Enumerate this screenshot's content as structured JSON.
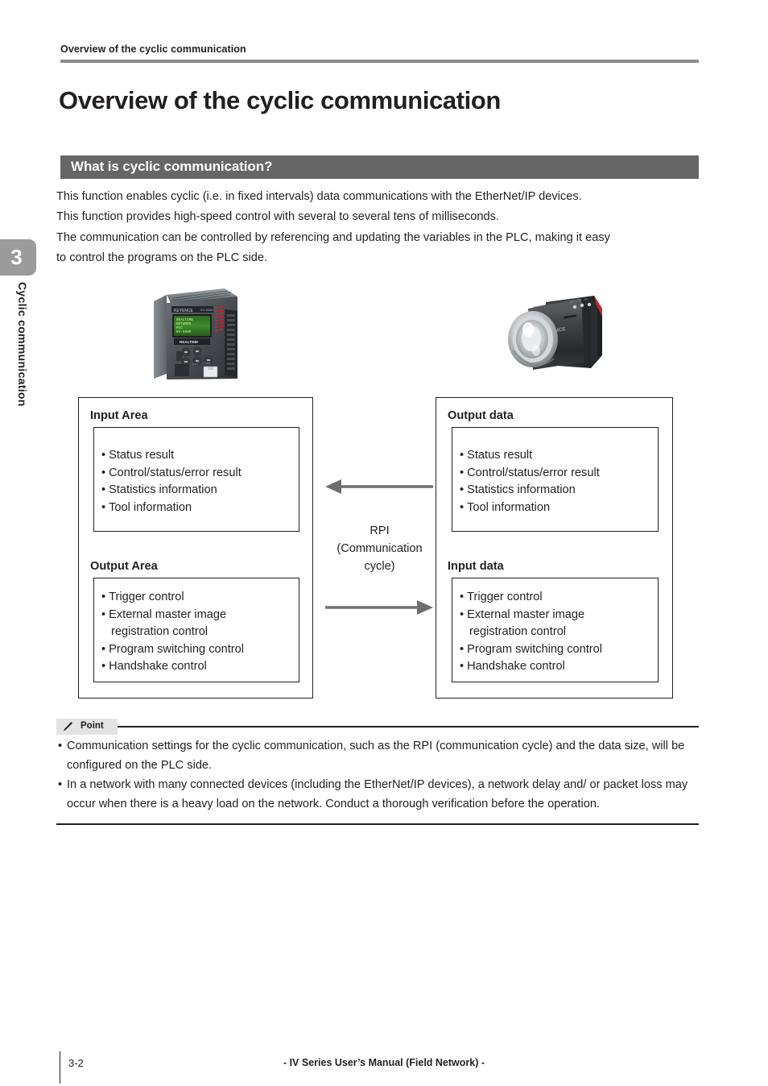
{
  "running_head": "Overview of the cyclic communication",
  "page_title": "Overview of the cyclic communication",
  "chapter_tab": {
    "number": "3",
    "label": "Cyclic communication"
  },
  "section": {
    "heading": "What is cyclic communication?",
    "paragraphs": [
      "This function enables cyclic (i.e. in fixed intervals) data communications with the EtherNet/IP devices.",
      "This function provides high-speed control with several to several tens of milliseconds.",
      "The communication can be controlled by referencing and updating the variables in the PLC, making it easy",
      "to control the programs on the PLC side."
    ]
  },
  "photos": [
    {
      "name": "plc-controller-photo",
      "caption": ""
    },
    {
      "name": "iv-vision-sensor-photo",
      "caption": ""
    }
  ],
  "diagram": {
    "left": {
      "top_block": {
        "title": "Input Area",
        "items": [
          "Status result",
          "Control/status/error result",
          "Statistics information",
          "Tool information"
        ]
      },
      "bottom_block": {
        "title": "Output Area",
        "items": [
          "Trigger control",
          "External master image",
          "Program switching control",
          "Handshake control"
        ],
        "continuation": "registration control"
      }
    },
    "right": {
      "top_block": {
        "title": "Output data",
        "items": [
          "Status result",
          "Control/status/error result",
          "Statistics information",
          "Tool information"
        ]
      },
      "bottom_block": {
        "title": "Input data",
        "items": [
          "Trigger control",
          "External master image",
          "Program switching control",
          "Handshake control"
        ],
        "continuation": "registration control"
      }
    },
    "center_label_lines": [
      "RPI",
      "(Communication",
      "cycle)"
    ],
    "arrow_color": "#6e6e6e"
  },
  "point": {
    "chip_label": "Point",
    "items": [
      "Communication settings for the cyclic communication, such as the RPI (communication cycle) and the data size, will be configured on the PLC side.",
      "In a network with many connected devices (including the EtherNet/IP devices), a network delay and/ or packet loss may occur when there is a heavy load on the network. Conduct a thorough verification before the operation."
    ]
  },
  "footer": {
    "page_number": "3-2",
    "center_text": "- IV Series User’s Manual (Field Network) -"
  },
  "colors": {
    "section_bar": "#666666",
    "head_rule": "#8c8c8c",
    "chapter_tab": "#9b9b9b",
    "point_chip": "#e3e3e3",
    "text": "#231f20"
  }
}
